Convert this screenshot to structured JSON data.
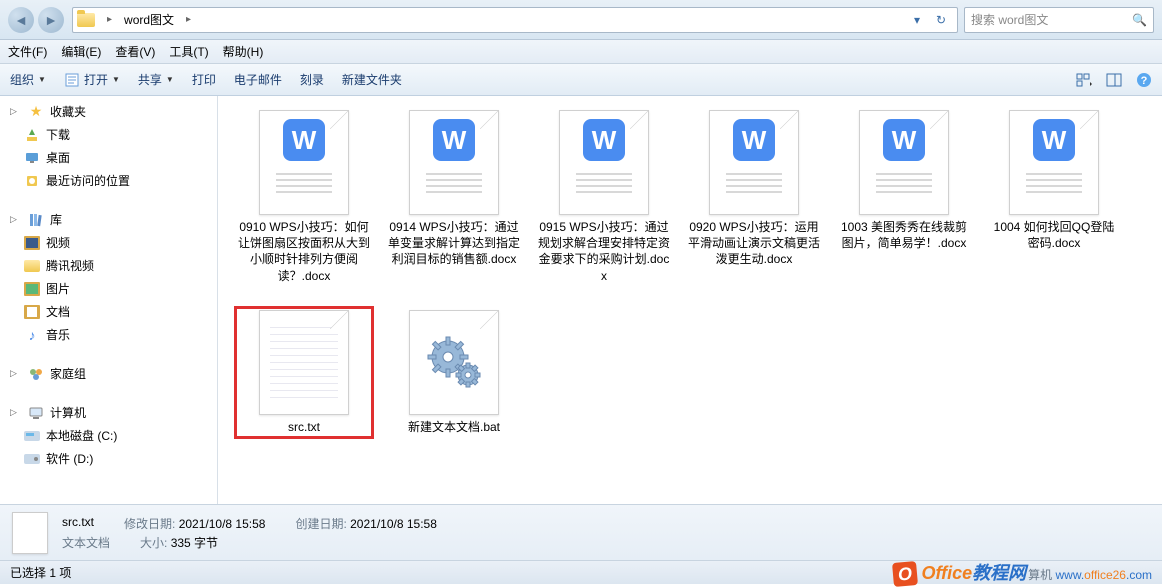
{
  "address": {
    "path_segment": "word图文",
    "search_placeholder": "搜索 word图文"
  },
  "menu": {
    "file": "文件(F)",
    "edit": "编辑(E)",
    "view": "查看(V)",
    "tools": "工具(T)",
    "help": "帮助(H)"
  },
  "toolbar": {
    "organize": "组织",
    "open": "打开",
    "share": "共享",
    "print": "打印",
    "email": "电子邮件",
    "burn": "刻录",
    "new_folder": "新建文件夹"
  },
  "sidebar": {
    "favorites": {
      "label": "收藏夹",
      "items": [
        "下载",
        "桌面",
        "最近访问的位置"
      ]
    },
    "libraries": {
      "label": "库",
      "items": [
        "视频",
        "腾讯视频",
        "图片",
        "文档",
        "音乐"
      ]
    },
    "homegroup": {
      "label": "家庭组"
    },
    "computer": {
      "label": "计算机",
      "items": [
        "本地磁盘 (C:)",
        "软件 (D:)"
      ]
    }
  },
  "files": [
    {
      "name": "0910 WPS小技巧：如何让饼图扇区按面积从大到小顺时针排列方便阅读？.docx",
      "type": "wps"
    },
    {
      "name": "0914  WPS小技巧：通过单变量求解计算达到指定利润目标的销售额.docx",
      "type": "wps"
    },
    {
      "name": "0915 WPS小技巧：通过规划求解合理安排特定资金要求下的采购计划.docx",
      "type": "wps"
    },
    {
      "name": "0920 WPS小技巧：运用平滑动画让演示文稿更活泼更生动.docx",
      "type": "wps"
    },
    {
      "name": "1003 美图秀秀在线裁剪图片，简单易学！.docx",
      "type": "wps"
    },
    {
      "name": "1004 如何找回QQ登陆密码.docx",
      "type": "wps"
    },
    {
      "name": "src.txt",
      "type": "txt",
      "selected": true
    },
    {
      "name": "新建文本文档.bat",
      "type": "bat"
    }
  ],
  "details": {
    "filename": "src.txt",
    "filetype": "文本文档",
    "mod_label": "修改日期:",
    "mod_value": "2021/10/8 15:58",
    "created_label": "创建日期:",
    "created_value": "2021/10/8 15:58",
    "size_label": "大小:",
    "size_value": "335 字节"
  },
  "status": {
    "selection": "已选择 1 项",
    "watermark_brand": "Office教程网",
    "watermark_url_prefix": "算机",
    "watermark_url": "www.office26.com"
  }
}
